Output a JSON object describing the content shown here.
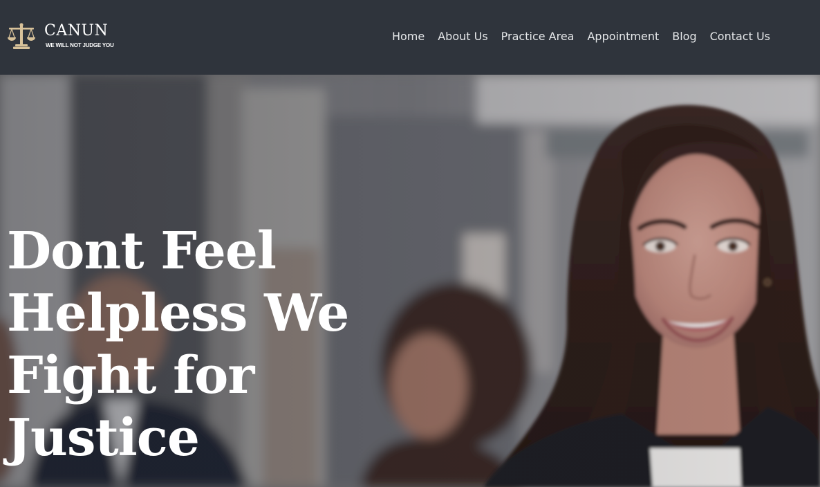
{
  "brand": {
    "name": "CANUN",
    "tagline": "WE WILL NOT JUDGE YOU",
    "logo_icon": "scales-of-justice-icon",
    "accent_color": "#d8c29a"
  },
  "nav": {
    "items": [
      {
        "label": "Home"
      },
      {
        "label": "About Us"
      },
      {
        "label": "Practice Area"
      },
      {
        "label": "Appointment"
      },
      {
        "label": "Blog"
      },
      {
        "label": "Contact Us"
      }
    ]
  },
  "hero": {
    "title_lines": [
      "Dont Feel",
      "Helpless We",
      "Fight for",
      "Justice"
    ]
  },
  "colors": {
    "header_bg": "#2f343c",
    "text": "#ffffff"
  }
}
